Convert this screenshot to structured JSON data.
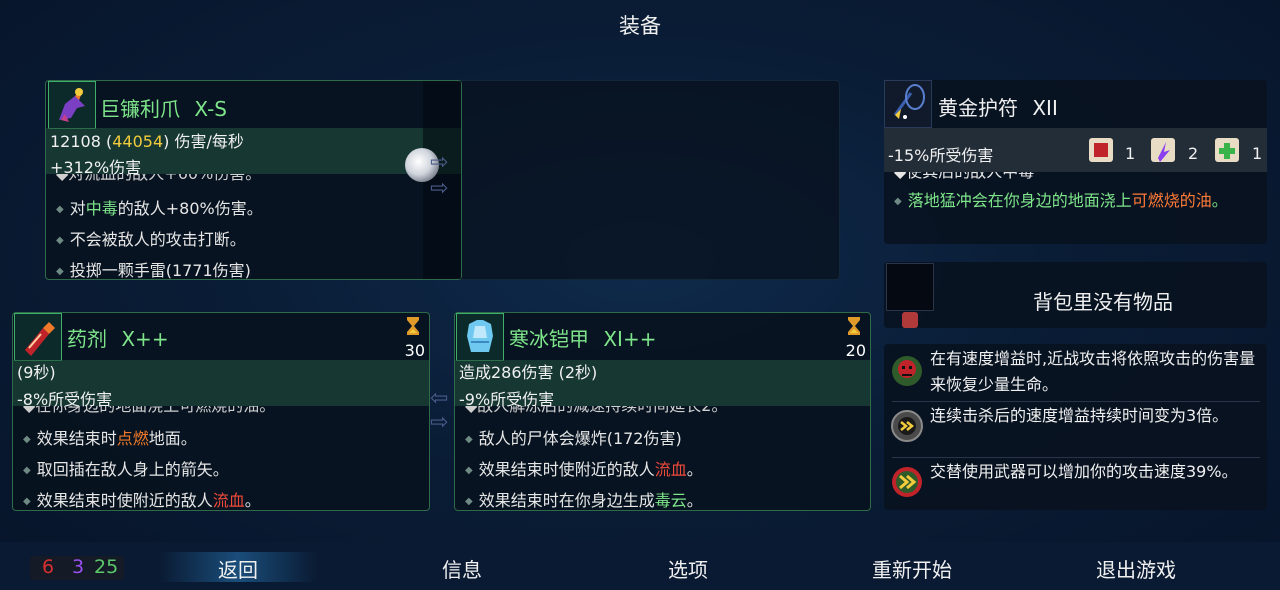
{
  "title": "装备",
  "weapon": {
    "name": "巨镰利爪",
    "level": "X-S",
    "dps_base": "12108",
    "dps_crit": "44054",
    "dps_unit": "伤害/每秒",
    "bonus": "+312%伤害",
    "mod_cut": "◆对流血的敌人+60%伤害。",
    "mod_poison_prefix": "对",
    "mod_poison_keyword": "中毒",
    "mod_poison_suffix": "的敌人+80%伤害。",
    "mod_interrupt": "不会被敌人的攻击打断。",
    "mod_grenade": "投掷一颗手雷(1771伤害)"
  },
  "amulet": {
    "name": "黄金护符",
    "level": "XII",
    "effect": "-15%所受伤害",
    "scroll_counts": [
      "1",
      "2",
      "1"
    ],
    "mod_cut": "◆使其后的敌人中毒",
    "mod_oil_prefix": "落地猛冲会在你身边的地面浇上",
    "mod_oil_keyword": "可燃烧的油",
    "mod_oil_suffix": "。"
  },
  "backpack": {
    "empty_text": "背包里没有物品"
  },
  "skill1": {
    "name": "药剂",
    "level": "X++",
    "cooldown": "30",
    "duration": "(9秒)",
    "effect": "-8%所受伤害",
    "mod_cut": "◆在你身边的地面浇上可燃烧的油。",
    "mod_ignite_prefix": "效果结束时",
    "mod_ignite_keyword": "点燃",
    "mod_ignite_suffix": "地面。",
    "mod_arrows": "取回插在敌人身上的箭矢。",
    "mod_bleed_prefix": "效果结束时使附近的敌人",
    "mod_bleed_keyword": "流血",
    "mod_bleed_suffix": "。"
  },
  "skill2": {
    "name": "寒冰铠甲",
    "level": "XI++",
    "cooldown": "20",
    "damage": "造成286伤害 (2秒)",
    "effect": "-9%所受伤害",
    "mod_cut": "◆敌人解冻后的减速持续时间延长2。",
    "mod_explode": "敌人的尸体会爆炸(172伤害)",
    "mod_bleed_prefix": "效果结束时使附近的敌人",
    "mod_bleed_keyword": "流血",
    "mod_bleed_suffix": "。",
    "mod_poison_prefix": "效果结束时在你身边生成",
    "mod_poison_keyword": "毒云",
    "mod_poison_suffix": "。"
  },
  "mutations": [
    {
      "icon": "skull-heal-icon",
      "text": "在有速度增益时,近战攻击将依照攻击的伤害量来恢复少量生命。"
    },
    {
      "icon": "speed-kill-icon",
      "text": "连续击杀后的速度增益持续时间变为3倍。"
    },
    {
      "icon": "alternate-speed-icon",
      "text": "交替使用武器可以增加你的攻击速度39%。"
    }
  ],
  "footer": {
    "red_count": "6",
    "purple_count": "3",
    "green_count": "25",
    "back": "返回",
    "info": "信息",
    "options": "选项",
    "restart": "重新开始",
    "quit": "退出游戏"
  },
  "colors": {
    "red_scroll": "#f04a3a",
    "purple_scroll": "#a35cf0",
    "green_scroll": "#7ee58a"
  }
}
